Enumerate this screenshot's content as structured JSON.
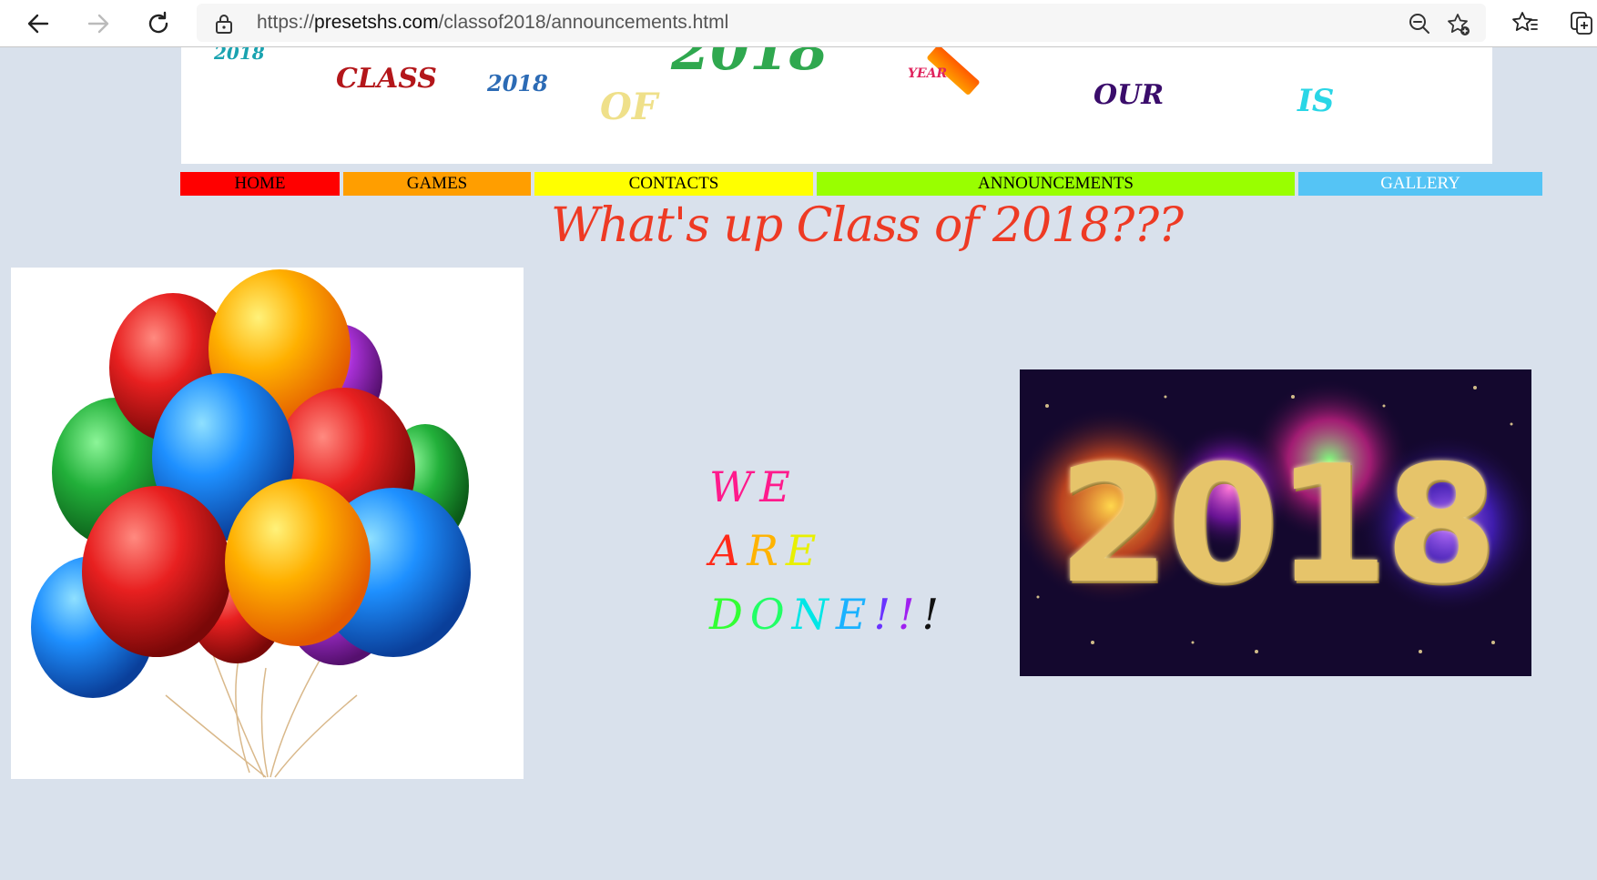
{
  "browser": {
    "url_prefix": "https://",
    "url_host": "presetshs.com",
    "url_path": "/classof2018/announcements.html"
  },
  "banner": {
    "words": [
      {
        "text": "2018",
        "color": "#1aa3b0"
      },
      {
        "text": "CLASS",
        "color": "#b3161a"
      },
      {
        "text": "2018",
        "color": "#2c6bb5"
      },
      {
        "text": "OF",
        "color": "#efe08a"
      },
      {
        "text": "2018",
        "color": "#2fa84f"
      },
      {
        "text": "YEAR",
        "color": "#e0245e"
      },
      {
        "text": "OUR",
        "color": "#3a0c6b"
      },
      {
        "text": "IS",
        "color": "#2ad6e6"
      }
    ]
  },
  "nav": {
    "items": [
      {
        "label": "HOME",
        "color": "#ff0000",
        "text_color": "#000000"
      },
      {
        "label": "GAMES",
        "color": "#ff9e00",
        "text_color": "#000000"
      },
      {
        "label": "CONTACTS",
        "color": "#ffff00",
        "text_color": "#000000"
      },
      {
        "label": "ANNOUNCEMENTS",
        "color": "#99ff00",
        "text_color": "#000000"
      },
      {
        "label": "GALLERY",
        "color": "#55c4f5",
        "text_color": "#ffffff"
      }
    ]
  },
  "heading": "What's up Class of 2018???",
  "announcement": {
    "lines": [
      [
        {
          "text": "W",
          "color": "#ff1a8c"
        },
        {
          "text": "E",
          "color": "#ff1a8c"
        }
      ],
      [
        {
          "text": "A",
          "color": "#ff2a1a"
        },
        {
          "text": "R",
          "color": "#ffb300"
        },
        {
          "text": "E",
          "color": "#e8f000"
        }
      ],
      [
        {
          "text": "D",
          "color": "#33ff33"
        },
        {
          "text": "O",
          "color": "#22ff66"
        },
        {
          "text": "N",
          "color": "#00e6e6"
        },
        {
          "text": "E",
          "color": "#1ab2ff"
        },
        {
          "text": "!",
          "color": "#6a33ff"
        },
        {
          "text": "!",
          "color": "#a020f0"
        },
        {
          "text": "!",
          "color": "#111111"
        }
      ]
    ]
  },
  "images": {
    "balloons": {
      "colors": [
        "#1e90ff",
        "#e82020",
        "#22b03a",
        "#ff9d00",
        "#a830d6"
      ]
    },
    "fireworks": {
      "year_text": "2018"
    }
  }
}
